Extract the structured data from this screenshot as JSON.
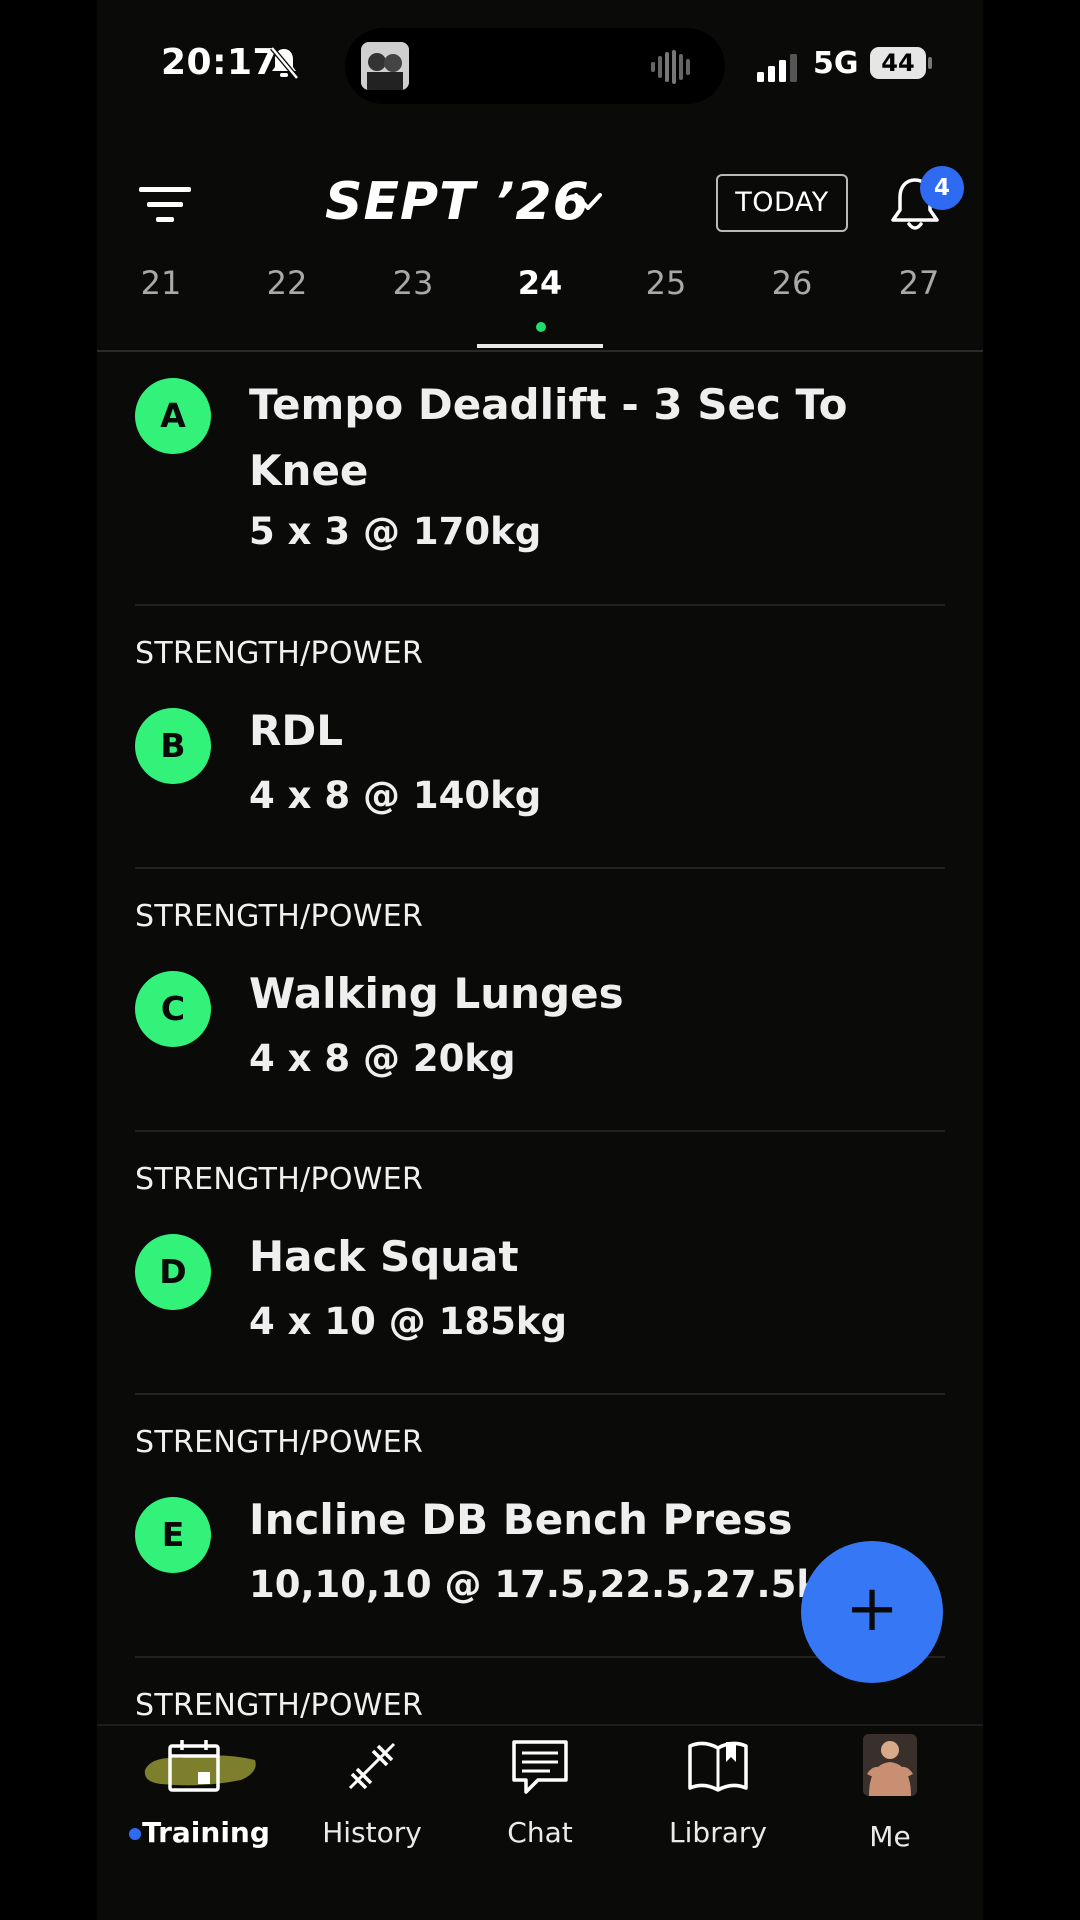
{
  "status_bar": {
    "time": "20:17",
    "network": "5G",
    "battery": "44"
  },
  "header": {
    "month": "SEPT ’26",
    "today_label": "TODAY",
    "notification_count": "4"
  },
  "dates": [
    {
      "day": "21",
      "active": false
    },
    {
      "day": "22",
      "active": false
    },
    {
      "day": "23",
      "active": false
    },
    {
      "day": "24",
      "active": true
    },
    {
      "day": "25",
      "active": false
    },
    {
      "day": "26",
      "active": false
    },
    {
      "day": "27",
      "active": false
    }
  ],
  "exercises": [
    {
      "category": "",
      "letter": "A",
      "name": "Tempo Deadlift - 3 Sec To Knee",
      "detail": "5 x 3 @ 170kg"
    },
    {
      "category": "STRENGTH/POWER",
      "letter": "B",
      "name": "RDL",
      "detail": "4 x 8 @ 140kg"
    },
    {
      "category": "STRENGTH/POWER",
      "letter": "C",
      "name": "Walking Lunges",
      "detail": "4 x 8 @ 20kg"
    },
    {
      "category": "STRENGTH/POWER",
      "letter": "D",
      "name": "Hack Squat",
      "detail": "4 x 10 @ 185kg"
    },
    {
      "category": "STRENGTH/POWER",
      "letter": "E",
      "name": "Incline DB Bench Press",
      "detail": "10,10,10 @ 17.5,22.5,27.5kg"
    },
    {
      "category": "STRENGTH/POWER",
      "letter": "",
      "name": "",
      "detail": ""
    }
  ],
  "fab": {
    "label": "+"
  },
  "nav": [
    {
      "label": "Training",
      "icon": "calendar-icon",
      "active": true
    },
    {
      "label": "History",
      "icon": "barbell-icon",
      "active": false
    },
    {
      "label": "Chat",
      "icon": "chat-icon",
      "active": false
    },
    {
      "label": "Library",
      "icon": "book-icon",
      "active": false
    },
    {
      "label": "Me",
      "icon": "avatar",
      "active": false
    }
  ],
  "colors": {
    "accent_green": "#33f27a",
    "accent_blue": "#3577f4",
    "background": "#0a0a08"
  }
}
